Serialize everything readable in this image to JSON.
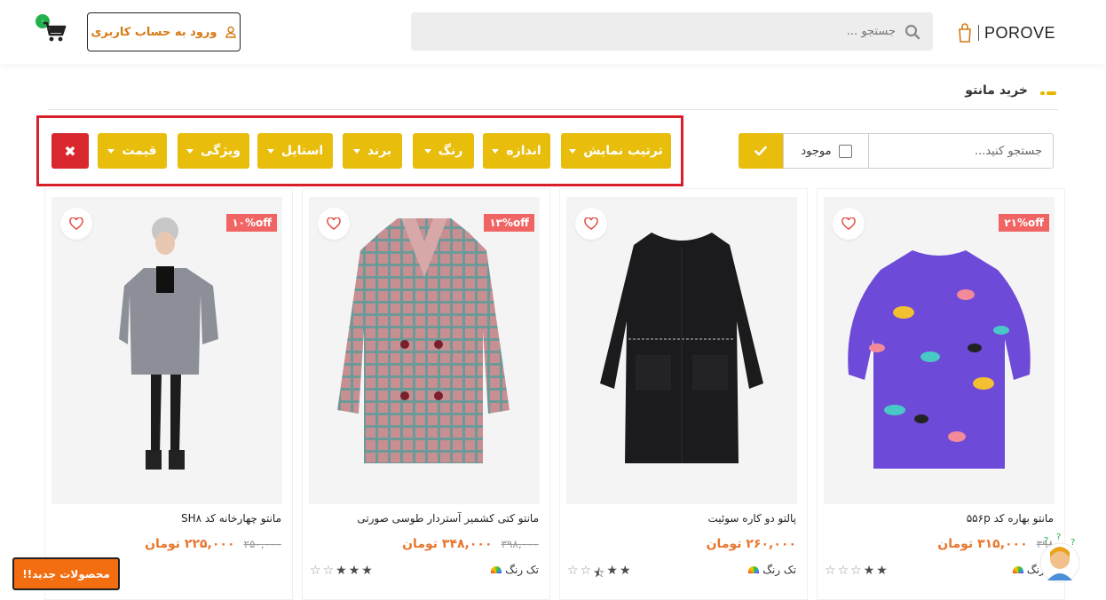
{
  "header": {
    "cart_count": "۰",
    "login_label": "ورود به حساب کاربری",
    "search_placeholder": "جستجو ...",
    "logo_text": "POROVE"
  },
  "page": {
    "title": "خرید مانتو"
  },
  "filters": {
    "buttons": [
      {
        "label": "ترتیب نمایش"
      },
      {
        "label": "اندازه"
      },
      {
        "label": "رنگ"
      },
      {
        "label": "برند"
      },
      {
        "label": "استایل"
      },
      {
        "label": "ویژگی"
      },
      {
        "label": "قیمت"
      }
    ],
    "clear_label": "✖",
    "search_placeholder": "جستجو کنید...",
    "in_stock_label": "موجود",
    "in_stock_checked": false
  },
  "products": [
    {
      "name": "مانتو بهاره کد ۵۵۶p",
      "price": "۳۱۵,۰۰۰ تومان",
      "old_price": "۳۹۸",
      "discount": "۲۱%off",
      "colors": "۴ رنگ",
      "rating": 2,
      "image": "purple-floral-coat"
    },
    {
      "name": "پالتو دو کاره سوئیت",
      "price": "۲۶۰,۰۰۰ تومان",
      "old_price": "",
      "discount": "",
      "colors": "تک رنگ",
      "rating": 2.5,
      "image": "black-coat"
    },
    {
      "name": "مانتو کتی کشمیر آستردار طوسی صورتی",
      "price": "۳۴۸,۰۰۰ تومان",
      "old_price": "۳۹۸,۰۰۰",
      "discount": "۱۳%off",
      "colors": "تک رنگ",
      "rating": 3,
      "image": "pink-plaid-coat"
    },
    {
      "name": "مانتو چهارخانه کد SH۸",
      "price": "۲۲۵,۰۰۰ تومان",
      "old_price": "۲۵۰,۰۰۰",
      "discount": "۱۰%off",
      "colors": "",
      "rating": 3,
      "image": "grey-check-coat"
    }
  ],
  "floating": {
    "new_products_label": "محصولات جدید!!"
  },
  "colors": {
    "accent": "#e9bd0c",
    "danger": "#d9272e",
    "price": "#e8762e",
    "discount": "#f06464",
    "new_products": "#f36e11"
  }
}
